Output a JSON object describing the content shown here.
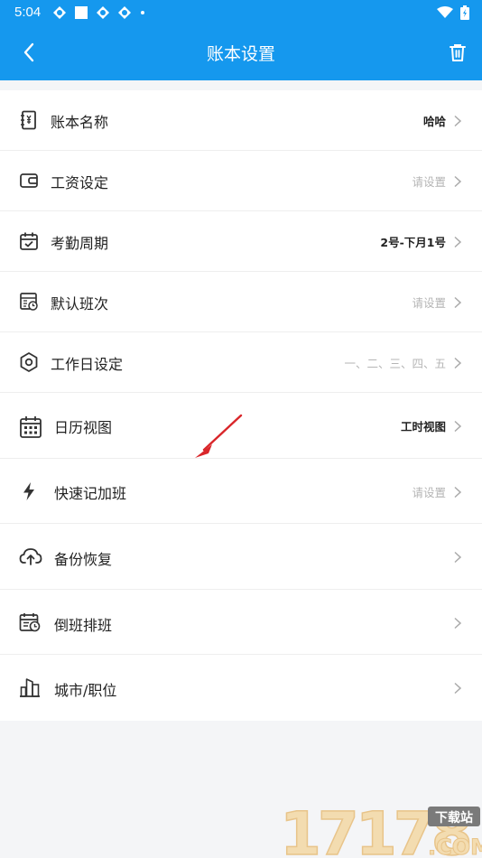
{
  "status_bar": {
    "time": "5:04"
  },
  "header": {
    "title": "账本设置"
  },
  "rows": [
    {
      "label": "账本名称",
      "value": "哈哈",
      "value_style": "set",
      "icon": "ledger-icon"
    },
    {
      "label": "工资设定",
      "value": "请设置",
      "value_style": "hint",
      "icon": "wallet-icon"
    },
    {
      "label": "考勤周期",
      "value": "2号-下月1号",
      "value_style": "set",
      "icon": "calendar-check-icon"
    },
    {
      "label": "默认班次",
      "value": "请设置",
      "value_style": "hint",
      "icon": "shift-clock-icon"
    },
    {
      "label": "工作日设定",
      "value": "一、二、三、四、五",
      "value_style": "hint",
      "icon": "hexagon-nut-icon"
    },
    {
      "label": "日历视图",
      "value": "工时视图",
      "value_style": "set",
      "icon": "calendar-grid-icon"
    },
    {
      "label": "快速记加班",
      "value": "请设置",
      "value_style": "hint",
      "icon": "lightning-icon"
    },
    {
      "label": "备份恢复",
      "value": "",
      "value_style": "hint",
      "icon": "cloud-upload-icon"
    },
    {
      "label": "倒班排班",
      "value": "",
      "value_style": "hint",
      "icon": "schedule-icon"
    },
    {
      "label": "城市/职位",
      "value": "",
      "value_style": "hint",
      "icon": "city-icon"
    }
  ],
  "watermark": {
    "text": "17178",
    "badge": "下载站",
    "suffix": ".COM"
  },
  "colors": {
    "header": "#1598ee",
    "annotation_arrow": "#d9262a"
  }
}
